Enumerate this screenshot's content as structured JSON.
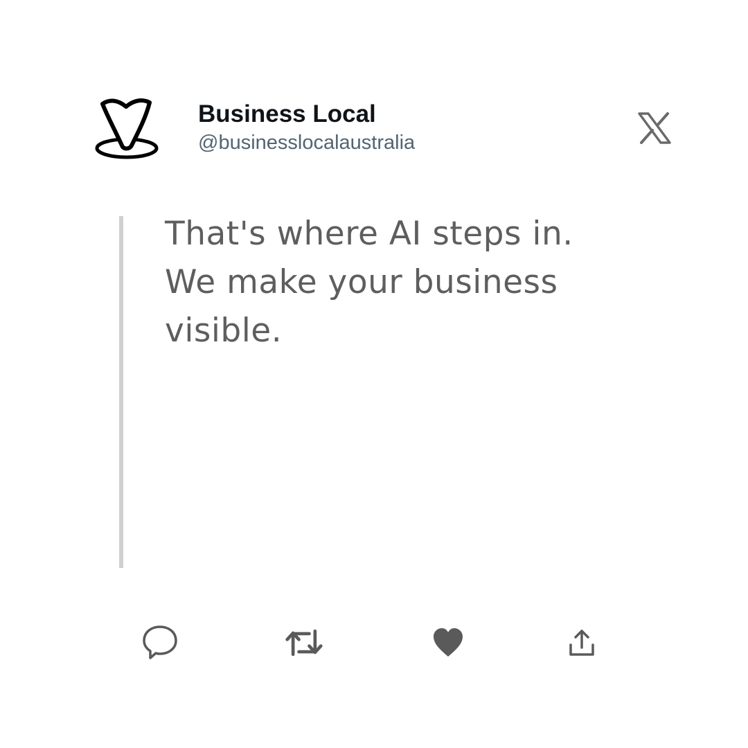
{
  "profile": {
    "name": "Business Local",
    "handle": "@businesslocalaustralia",
    "avatar_icon": "business-local-pin-logo"
  },
  "platform_icon": "x-logo-icon",
  "tweet": {
    "lines": [
      "That's where AI steps in.",
      "We make your business",
      "visible."
    ]
  },
  "actions": {
    "reply_icon": "reply-icon",
    "retweet_icon": "retweet-icon",
    "like_icon": "heart-icon",
    "share_icon": "share-icon"
  },
  "colors": {
    "name": "#0f1419",
    "handle": "#536471",
    "body_text": "#5e5e5e",
    "quote_bar": "#d0d0d0",
    "icons": "#5a5a5a"
  }
}
